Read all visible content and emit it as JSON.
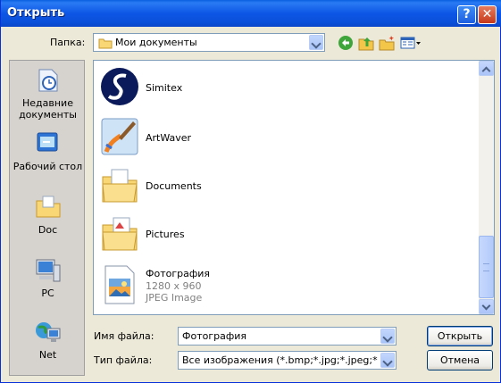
{
  "window": {
    "title": "Открыть",
    "help": "?",
    "close": "✕"
  },
  "lookin": {
    "label": "Папка:",
    "value": "Мои документы"
  },
  "places": [
    {
      "label": "Недавние документы",
      "icon": "recent-documents-icon"
    },
    {
      "label": "Рабочий стол",
      "icon": "desktop-icon"
    },
    {
      "label": "Doc",
      "icon": "folder-icon"
    },
    {
      "label": "PC",
      "icon": "computer-icon"
    },
    {
      "label": "Net",
      "icon": "network-icon"
    }
  ],
  "files": [
    {
      "name": "Simitex",
      "icon": "simitex-logo-icon"
    },
    {
      "name": "ArtWaver",
      "icon": "artwaver-app-icon"
    },
    {
      "name": "Documents",
      "icon": "folder-icon"
    },
    {
      "name": "Pictures",
      "icon": "pictures-folder-icon"
    },
    {
      "name": "Фотография",
      "size": "1280 x 960",
      "type": "JPEG Image",
      "icon": "jpeg-image-icon"
    }
  ],
  "filename": {
    "label": "Имя файла:",
    "value": "Фотография"
  },
  "filetype": {
    "label": "Тип файла:",
    "value": "Все изображения (*.bmp;*.jpg;*.jpeg;*.exif;*.gi"
  },
  "buttons": {
    "open": "Открыть",
    "cancel": "Отмена"
  },
  "colors": {
    "titlebar": "#0a5fe0",
    "face": "#ece9d8",
    "border": "#7f9db9"
  }
}
